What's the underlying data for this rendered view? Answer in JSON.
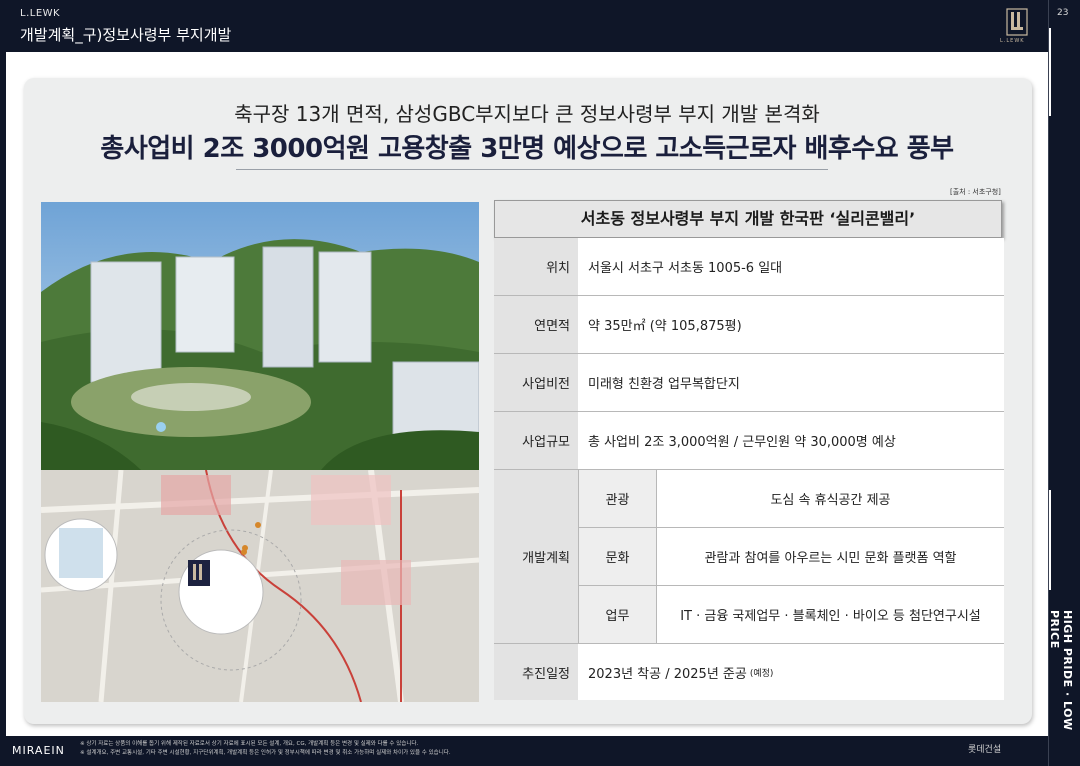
{
  "header": {
    "brand": "L.LEWK",
    "title": "개발계획_구)정보사령부 부지개발",
    "page_number": "23",
    "logo_caption": "L.LEWK"
  },
  "side": {
    "slogan": "HIGH PRIDE · LOW PRICE"
  },
  "main": {
    "subhead": "축구장 13개 면적, 삼성GBC부지보다 큰 정보사령부 부지 개발 본격화",
    "headline": "총사업비 2조 3000억원 고용창출 3만명 예상으로 고소득근로자 배후수요 풍부",
    "source": "[출처 : 서초구청]"
  },
  "table": {
    "title": "서초동 정보사령부 부지 개발 한국판 ‘실리콘밸리’",
    "rows": [
      {
        "label": "위치",
        "value": "서울시 서초구 서초동 1005-6 일대"
      },
      {
        "label": "연면적",
        "value": "약 35만㎡ (약 105,875평)"
      },
      {
        "label": "사업비전",
        "value": "미래형 친환경 업무복합단지"
      },
      {
        "label": "사업규모",
        "value": "총 사업비 2조 3,000억원 / 근무인원 약 30,000명 예상"
      }
    ],
    "plan_label": "개발계획",
    "plan_items": [
      {
        "label": "관광",
        "value": "도심 속 휴식공간 제공"
      },
      {
        "label": "문화",
        "value": "관람과 참여를 아우르는 시민 문화 플랫폼 역할"
      },
      {
        "label": "업무",
        "value": "IT · 금융 국제업무 · 블록체인 · 바이오 등 첨단연구시설"
      }
    ],
    "schedule_label": "추진일정",
    "schedule_value": "2023년 착공 / 2025년 준공",
    "schedule_note": "(예정)"
  },
  "map": {
    "inset_logo": "L.LEWK"
  },
  "footer": {
    "brand": "MIRAEIN",
    "note_line1": "※ 상기 자료는 상품의 이해를 돕기 위해 제작된 자료로서 상기 자료에 표시된 모든 설계, 개요, CG, 개발계획 등은 변경 및 실제와 다를 수 있습니다.",
    "note_line2": "※ 설계개요, 주변 교통시설, 기타 주변 시설현황, 지구단위계획, 개발계획 등은 인허가 및 정부시책에 따라 변경 및 취소 가능하며 실제와 차이가 있을 수 있습니다.",
    "company": "롯데건설"
  },
  "colors": {
    "navy": "#0f1628",
    "card": "#edeeee",
    "headline": "#1a1f3c"
  }
}
